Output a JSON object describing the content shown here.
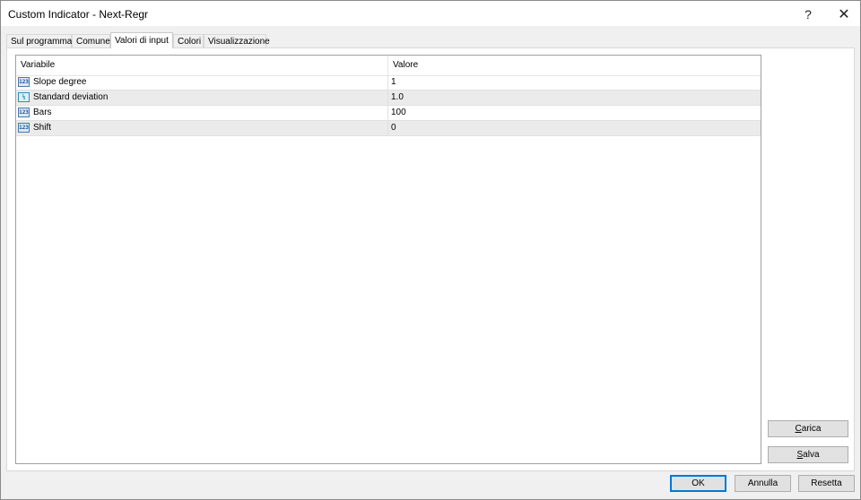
{
  "window": {
    "title": "Custom Indicator - Next-Regr",
    "help_glyph": "?",
    "close_glyph": "✕"
  },
  "tabs": [
    {
      "label": "Sul programma",
      "active": false
    },
    {
      "label": "Comune",
      "active": false
    },
    {
      "label": "Valori di input",
      "active": true
    },
    {
      "label": "Colori",
      "active": false
    },
    {
      "label": "Visualizzazione",
      "active": false
    }
  ],
  "grid": {
    "columns": {
      "variable": "Variabile",
      "value": "Valore"
    },
    "rows": [
      {
        "icon": "integer-type-icon",
        "icon_text": "123",
        "name": "Slope degree",
        "value": "1"
      },
      {
        "icon": "double-type-icon",
        "icon_text": "½",
        "name": "Standard deviation",
        "value": "1.0"
      },
      {
        "icon": "integer-type-icon",
        "icon_text": "123",
        "name": "Bars",
        "value": "100"
      },
      {
        "icon": "integer-type-icon",
        "icon_text": "123",
        "name": "Shift",
        "value": "0"
      }
    ]
  },
  "side_buttons": {
    "load": {
      "accel": "C",
      "rest": "arica"
    },
    "save": {
      "accel": "S",
      "rest": "alva"
    }
  },
  "footer_buttons": {
    "ok": "OK",
    "cancel": "Annulla",
    "reset": "Resetta"
  },
  "colors": {
    "selection_border": "#0078d7",
    "alt_row": "#ebebeb"
  }
}
